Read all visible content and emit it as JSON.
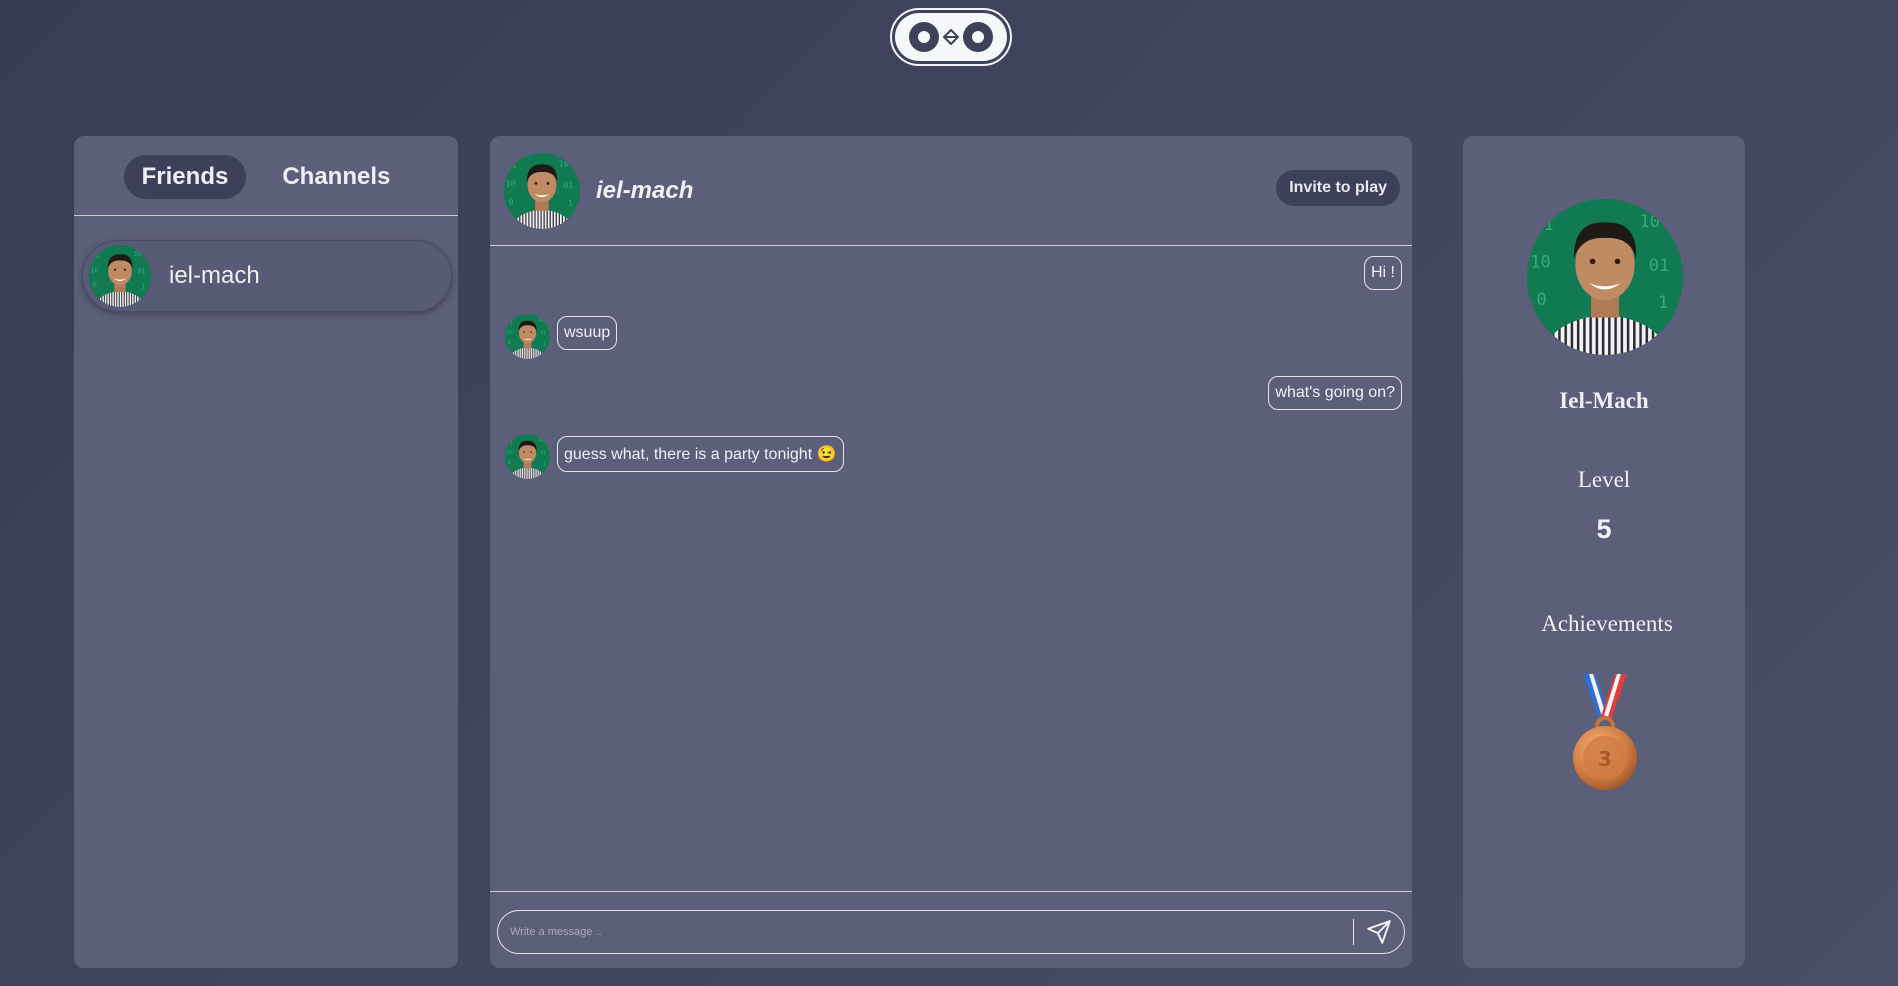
{
  "app": {
    "logo": "owl-logo"
  },
  "tabs": [
    {
      "label": "Friends",
      "active": true
    },
    {
      "label": "Channels",
      "active": false
    }
  ],
  "friends": [
    {
      "name": "iel-mach"
    }
  ],
  "chat": {
    "title": "iel-mach",
    "invite_label": "Invite to play",
    "messages": [
      {
        "text": "Hi !",
        "from": "me"
      },
      {
        "text": "wsuup",
        "from": "them"
      },
      {
        "text": "what's going on?",
        "from": "me"
      },
      {
        "text": "guess what, there is a party tonight 😉",
        "from": "them"
      }
    ],
    "composer": {
      "placeholder": "Write a message .."
    }
  },
  "profile": {
    "name": "Iel-Mach",
    "level_label": "Level",
    "level": "5",
    "achievements_label": "Achievements",
    "achievements": [
      {
        "icon": "bronze-medal-icon"
      }
    ]
  },
  "colors": {
    "background": "#41455f",
    "panel": "#5b5f79",
    "accent_dark": "#3c4058",
    "text": "#eef0f5"
  }
}
